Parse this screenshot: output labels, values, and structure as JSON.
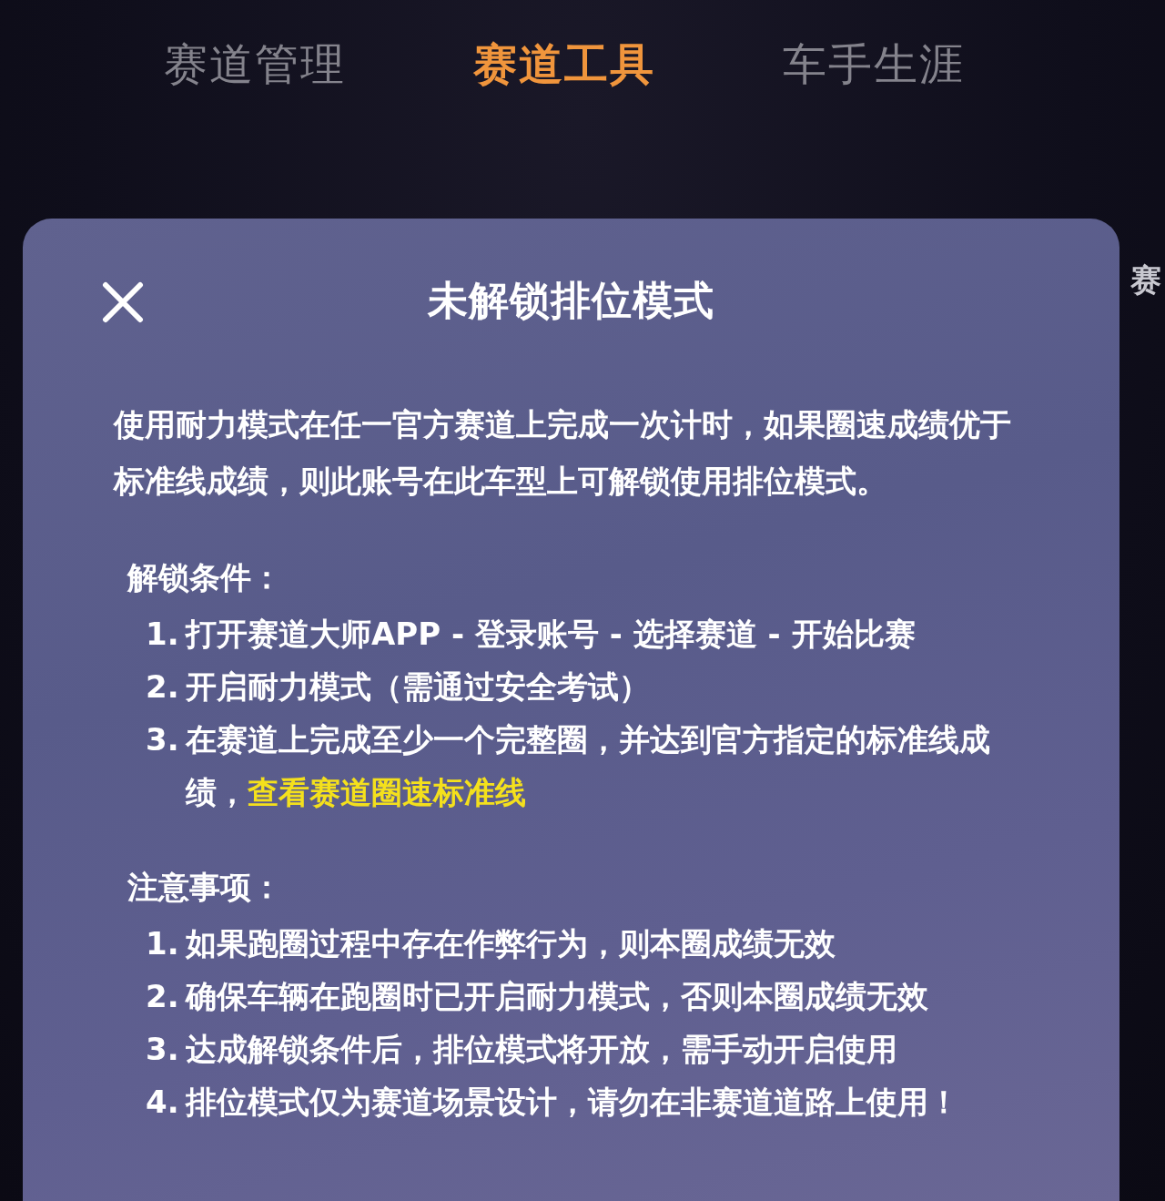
{
  "tabs": [
    {
      "label": "赛道管理",
      "selected": false
    },
    {
      "label": "赛道工具",
      "selected": true
    },
    {
      "label": "车手生涯",
      "selected": false
    }
  ],
  "side_label": "赛",
  "dialog": {
    "title": "未解锁排位模式",
    "intro": "使用耐力模式在任一官方赛道上完成一次计时，如果圈速成绩优于标准线成绩，则此账号在此车型上可解锁使用排位模式。",
    "sections": [
      {
        "heading": "解锁条件：",
        "items": [
          {
            "number": "1.",
            "text": "打开赛道大师APP - 登录账号 - 选择赛道 - 开始比赛"
          },
          {
            "number": "2.",
            "text": "开启耐力模式（需通过安全考试）"
          },
          {
            "number": "3.",
            "text": "在赛道上完成至少一个完整圈，并达到官方指定的标准线成绩，",
            "link": "查看赛道圈速标准线"
          }
        ]
      },
      {
        "heading": "注意事项：",
        "items": [
          {
            "number": "1.",
            "text": "如果跑圈过程中存在作弊行为，则本圈成绩无效"
          },
          {
            "number": "2.",
            "text": "确保车辆在跑圈时已开启耐力模式，否则本圈成绩无效"
          },
          {
            "number": "3.",
            "text": "达成解锁条件后，排位模式将开放，需手动开启使用"
          },
          {
            "number": "4.",
            "text": "排位模式仅为赛道场景设计，请勿在非赛道道路上使用！"
          }
        ]
      }
    ]
  }
}
